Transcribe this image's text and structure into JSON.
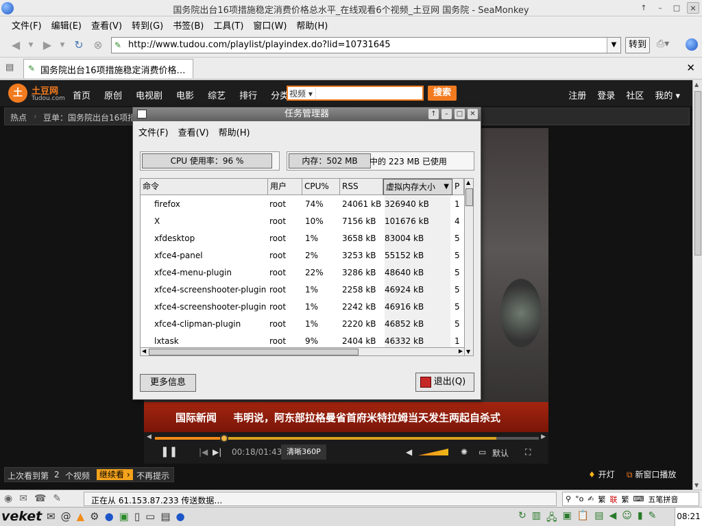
{
  "window": {
    "title": "国务院出台16项措施稳定消费价格总水平_在线观看6个视频_土豆网 国务院 - SeaMonkey",
    "controls": [
      "↑",
      "–",
      "□",
      "✕"
    ]
  },
  "menubar": [
    "文件(F)",
    "编辑(E)",
    "查看(V)",
    "转到(G)",
    "书签(B)",
    "工具(T)",
    "窗口(W)",
    "帮助(H)"
  ],
  "navbar": {
    "url": "http://www.tudou.com/playlist/playindex.do?lid=10731645",
    "go_label": "转到"
  },
  "tabs": {
    "active_label": "国务院出台16项措施稳定消费价格…",
    "close": "✕"
  },
  "tudou": {
    "logo_text": "土豆网",
    "logo_sub": "Tudou.com",
    "nav_links": [
      "首页",
      "原创",
      "电视剧",
      "电影",
      "综艺",
      "排行",
      "分类 ▾"
    ],
    "search_category": "视频 ▾",
    "search_button": "搜索",
    "right_links": [
      "注册",
      "登录",
      "社区",
      "我的 ▾"
    ],
    "crumb_hot": "热点",
    "crumb_title": "豆单：国务院出台16项措",
    "news_badge": "国际新闻",
    "news_ticker": "韦明说，阿东部拉格曼省首府米特拉姆当天发生两起自杀式",
    "player": {
      "time": "00:18/01:43",
      "quality": "清晰360P",
      "default_label": "默认",
      "progress_pct": 18,
      "buffered_pct": 89
    },
    "resume": {
      "prefix": "上次看到第",
      "count": "2",
      "suffix": "个视频",
      "continue": "继续看 ›",
      "dismiss": "不再提示"
    },
    "light_label": "开灯",
    "new_window_label": "新窗口播放"
  },
  "status": {
    "text": "正在从 61.153.87.233 传送数据…",
    "ime": [
      "繁",
      "联",
      "繁",
      "五笔拼音"
    ]
  },
  "taskbar": {
    "brand": "veket",
    "clock": "08:21"
  },
  "taskmgr": {
    "title": "任务管理器",
    "menus": [
      "文件(F)",
      "查看(V)",
      "帮助(H)"
    ],
    "cpu_label": "CPU 使用率：96 %",
    "cpu_usage_pct": 96,
    "mem_label": "内存：502 MB",
    "mem_used_text": "中的 223 MB 已使用",
    "columns": [
      "命令",
      "用户",
      "CPU%",
      "RSS",
      "虚拟内存大小",
      "P"
    ],
    "processes": [
      {
        "cmd": "firefox",
        "user": "root",
        "cpu": "74%",
        "rss": "24061 kB",
        "vsz": "326940 kB",
        "p": "1"
      },
      {
        "cmd": "X",
        "user": "root",
        "cpu": "10%",
        "rss": "7156 kB",
        "vsz": "101676 kB",
        "p": "4"
      },
      {
        "cmd": "xfdesktop",
        "user": "root",
        "cpu": "1%",
        "rss": "3658 kB",
        "vsz": "83004 kB",
        "p": "5"
      },
      {
        "cmd": "xfce4-panel",
        "user": "root",
        "cpu": "2%",
        "rss": "3253 kB",
        "vsz": "55152 kB",
        "p": "5"
      },
      {
        "cmd": "xfce4-menu-plugin",
        "user": "root",
        "cpu": "22%",
        "rss": "3286 kB",
        "vsz": "48640 kB",
        "p": "5"
      },
      {
        "cmd": "xfce4-screenshooter-plugin",
        "user": "root",
        "cpu": "1%",
        "rss": "2258 kB",
        "vsz": "46924 kB",
        "p": "5"
      },
      {
        "cmd": "xfce4-screenshooter-plugin",
        "user": "root",
        "cpu": "1%",
        "rss": "2242 kB",
        "vsz": "46916 kB",
        "p": "5"
      },
      {
        "cmd": "xfce4-clipman-plugin",
        "user": "root",
        "cpu": "1%",
        "rss": "2220 kB",
        "vsz": "46852 kB",
        "p": "5"
      },
      {
        "cmd": "lxtask",
        "user": "root",
        "cpu": "9%",
        "rss": "2404 kB",
        "vsz": "46332 kB",
        "p": "1"
      }
    ],
    "more_info": "更多信息",
    "quit": "退出(Q)"
  }
}
